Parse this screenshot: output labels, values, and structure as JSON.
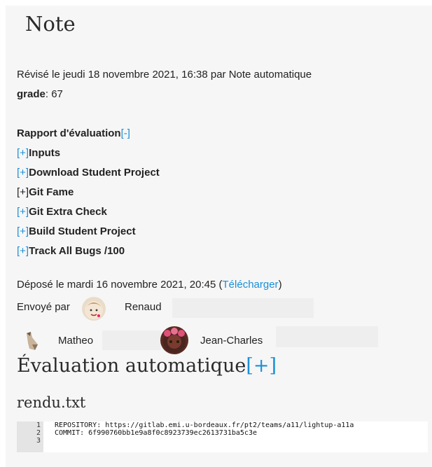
{
  "page": {
    "title": "Note"
  },
  "revision": {
    "text": "Révisé le jeudi 18 novembre 2021, 16:38 par Note automatique",
    "grade_label": "grade",
    "grade_value": ": 67"
  },
  "report": {
    "title": "Rapport d'évaluation",
    "title_toggle": "[-]",
    "items": [
      {
        "toggle": "[+]",
        "label": "Inputs",
        "toggle_is_link": true
      },
      {
        "toggle": "[+]",
        "label": "Download Student Project",
        "toggle_is_link": true
      },
      {
        "toggle": "[+]",
        "label": "Git Fame",
        "toggle_is_link": false
      },
      {
        "toggle": "[+]",
        "label": "Git Extra Check",
        "toggle_is_link": true
      },
      {
        "toggle": "[+]",
        "label": "Build Student Project",
        "toggle_is_link": true
      },
      {
        "toggle": "[+]",
        "label": "Track All Bugs /100",
        "toggle_is_link": true
      }
    ]
  },
  "submission": {
    "text": "Déposé le mardi 16 novembre 2021, 20:45 (",
    "download_link": "Télécharger",
    "text_end": ")",
    "sent_by": "Envoyé par",
    "users": [
      "Renaud",
      "Matheo",
      "Jean-Charles"
    ]
  },
  "auto_eval": {
    "title": "Évaluation automatique",
    "toggle": "[+]"
  },
  "file": {
    "name": "rendu.txt",
    "lines": [
      {
        "num": "1",
        "text": "REPOSITORY: https://gitlab.emi.u-bordeaux.fr/pt2/teams/a11/lightup-a11a"
      },
      {
        "num": "2",
        "text": "COMMIT: 6f990760bb1e9a8f0c8923739ec2613731ba5c3e"
      },
      {
        "num": "3",
        "text": ""
      }
    ]
  },
  "colors": {
    "link": "#1a8fd8",
    "panel_bg": "#f6f6f6"
  }
}
